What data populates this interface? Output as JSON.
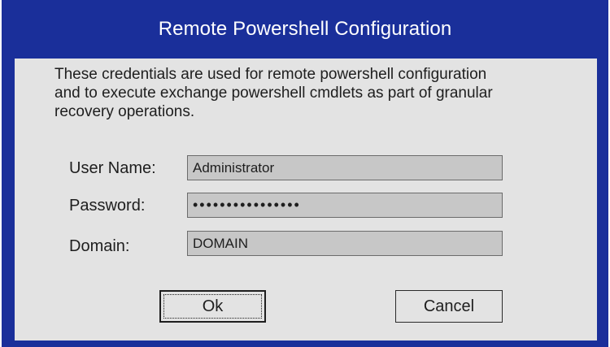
{
  "dialog": {
    "title": "Remote Powershell Configuration",
    "description": "These credentials are used for remote powershell configuration\n and to execute exchange powershell cmdlets as part of granular\nrecovery operations."
  },
  "form": {
    "username_label": "User Name:",
    "username_value": "Administrator",
    "password_label": "Password:",
    "password_value": "••••••••••••••••",
    "domain_label": "Domain:",
    "domain_value": "DOMAIN"
  },
  "buttons": {
    "ok_label": "Ok",
    "cancel_label": "Cancel"
  },
  "colors": {
    "title_bar": "#1a2f9a",
    "client_background": "#e3e3e3",
    "field_background": "#c7c7c7"
  }
}
